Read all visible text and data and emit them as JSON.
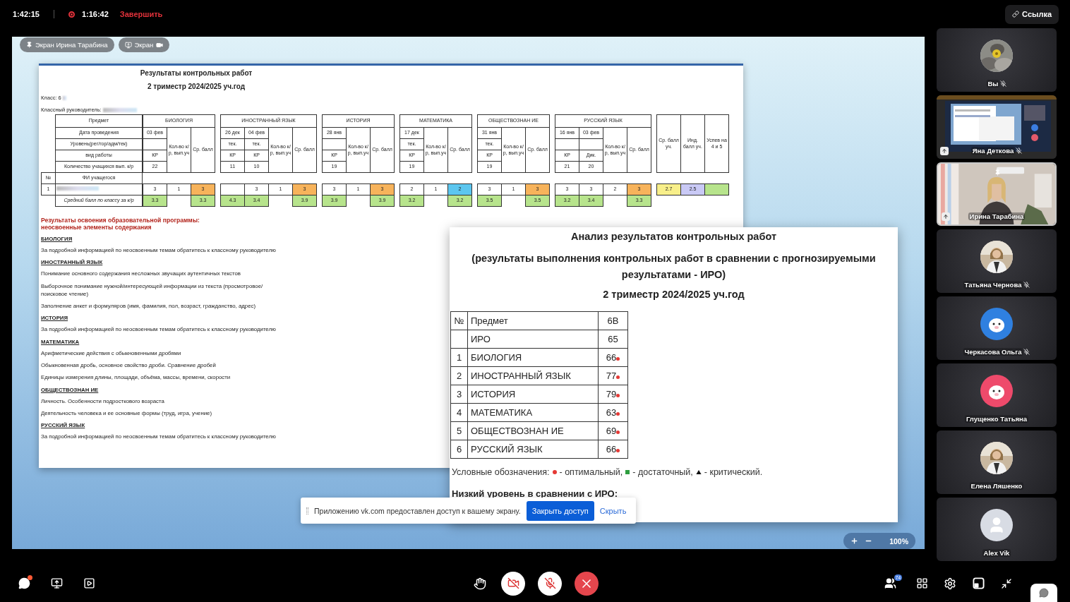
{
  "top_bar": {
    "elapsed": "1:42:15",
    "recording": {
      "on": true,
      "time": "1:16:42",
      "stop": "Завершить"
    },
    "link_button": "Ссылка"
  },
  "screen_tags": [
    {
      "kind": "pinned",
      "label": "Экран Ирина Тарабина"
    },
    {
      "kind": "own",
      "label": "Экран"
    }
  ],
  "document": {
    "title": "Результаты контрольных работ",
    "subtitle": "2 триместр 2024/2025 уч.год",
    "class_label": "Класс: 6",
    "teacher_label": "Классный руководитель:",
    "table": {
      "row_labels": [
        "Предмет",
        "Дата проведения",
        "Уровень(рег/гор/адм/тек)",
        "вид работы",
        "Количество учащихся вып. к/р"
      ],
      "number_label": "№",
      "name_label": "ФИ учащегося",
      "student_number": "1",
      "class_avg_label": "Средний балл по классу за к/р",
      "subjects": [
        {
          "name": "БИОЛОГИЯ",
          "count_label": "Кол-во к/р, вып.уч",
          "avg_label": "Ср. балл",
          "works": [
            {
              "date": "03 фев",
              "type": "КР",
              "count": "22",
              "mark": "3",
              "class_avg": "3.3"
            }
          ],
          "works_done": "1",
          "avg": {
            "value": "3",
            "color": "#f7b35b"
          },
          "class_avg": "3.3"
        },
        {
          "name": "ИНОСТРАННЫЙ ЯЗЫК",
          "count_label": "Кол-во к/р, вып.уч",
          "avg_label": "Ср. балл",
          "works": [
            {
              "date": "26 дек",
              "level": "тек.",
              "type": "КР",
              "count": "11",
              "class_avg": "4.3"
            },
            {
              "date": "04 фев",
              "level": "тек.",
              "type": "КР",
              "count": "10",
              "mark": "3",
              "class_avg": "3.4"
            }
          ],
          "works_done": "1",
          "avg": {
            "value": "3",
            "color": "#f7b35b"
          },
          "class_avg": "3.9"
        },
        {
          "name": "ИСТОРИЯ",
          "count_label": "Кол-во к/р, вып.уч",
          "avg_label": "Ср. балл",
          "works": [
            {
              "date": "28 янв",
              "type": "КР",
              "count": "19",
              "mark": "3",
              "class_avg": "3.9"
            }
          ],
          "works_done": "1",
          "avg": {
            "value": "3",
            "color": "#f7b35b"
          },
          "class_avg": "3.9"
        },
        {
          "name": "МАТЕМАТИКА",
          "count_label": "Кол-во к/р, вып.уч",
          "avg_label": "Ср. балл",
          "works": [
            {
              "date": "17 дек",
              "level": "тек.",
              "type": "КР",
              "count": "19",
              "mark": "2",
              "class_avg": "3.2"
            }
          ],
          "works_done": "1",
          "avg": {
            "value": "2",
            "color": "#5cc6ef"
          },
          "class_avg": "3.2"
        },
        {
          "name": "ОБЩЕСТВОЗНАН ИЕ",
          "count_label": "Кол-во к/р, вып.уч",
          "avg_label": "Ср. балл",
          "works": [
            {
              "date": "31 янв",
              "level": "тек.",
              "type": "КР",
              "count": "19",
              "mark": "3",
              "class_avg": "3.5"
            }
          ],
          "works_done": "1",
          "avg": {
            "value": "3",
            "color": "#f7b35b"
          },
          "class_avg": "3.5"
        },
        {
          "name": "РУССКИЙ ЯЗЫК",
          "count_label": "Кол-во к/р, вып.уч",
          "avg_label": "Ср. балл",
          "works": [
            {
              "date": "16 янв",
              "type": "КР",
              "count": "21",
              "mark": "3",
              "class_avg": "3.2"
            },
            {
              "date": "03 фев",
              "type": "Дик.",
              "count": "20",
              "mark": "3",
              "class_avg": "3.4"
            }
          ],
          "works_done": "2",
          "avg": {
            "value": "3",
            "color": "#f7b35b"
          },
          "class_avg": "3.3"
        }
      ],
      "summary": [
        {
          "label": "Ср. балл уч.",
          "value": "2.7",
          "color": "#f8ef8a"
        },
        {
          "label": "Инд. балл уч.",
          "value": "2.5",
          "color": "#c9c9f5"
        },
        {
          "label": "Успев на 4 и 5",
          "color": "#b7e48c"
        }
      ]
    },
    "results": {
      "heading": [
        "Результаты освоения образовательной программы:",
        "неосвоенные элементы содержания"
      ],
      "sections": [
        {
          "subject": "БИОЛОГИЯ",
          "items": [
            "За подробной информацией по неосвоенным темам обратитесь к классному руководителю"
          ]
        },
        {
          "subject": "ИНОСТРАННЫЙ ЯЗЫК",
          "items": [
            "Понимание основного содержания несложных звучащих аутентичных текстов",
            "Выборочное понимание нужной/интересующей информации из текста (просмотровое/ поисковое чтение)",
            "Заполнение анкет и формуляров (имя, фамилия, пол, возраст, гражданство, адрес)"
          ]
        },
        {
          "subject": "ИСТОРИЯ",
          "items": [
            "За подробной информацией по неосвоенным темам обратитесь к классному руководителю"
          ]
        },
        {
          "subject": "МАТЕМАТИКА",
          "items": [
            "Арифметические действия с обыкновенными дробями",
            "Обыкновенная дробь, основное свойство дроби. Сравнение дробей",
            "Единицы измерения длины, площади, объёма, массы, времени, скорости"
          ]
        },
        {
          "subject": "ОБЩЕСТВОЗНАН ИЕ",
          "items": [
            "Личность. Особенности подросткового возраста",
            "Деятельность человека и ее основные формы (труд, игра, учение)"
          ]
        },
        {
          "subject": "РУССКИЙ ЯЗЫК",
          "items": [
            "За подробной информацией по неосвоенным темам обратитесь к классному руководителю"
          ]
        }
      ]
    }
  },
  "analysis": {
    "title": "Анализ результатов контрольных работ",
    "subtitle": "(результаты выполнения контрольных работ в сравнении с прогнозируемыми результатами - ИРО)",
    "period": "2 триместр 2024/2025 уч.год",
    "columns": [
      "№",
      "Предмет",
      "6В"
    ],
    "rows": [
      {
        "subject": "ИРО",
        "value": "65"
      },
      {
        "number": "1",
        "subject": "БИОЛОГИЯ",
        "value": "66",
        "kind": "dot",
        "color": "#e53935"
      },
      {
        "number": "2",
        "subject": "ИНОСТРАННЫЙ ЯЗЫК",
        "value": "77",
        "kind": "dot",
        "color": "#e53935"
      },
      {
        "number": "3",
        "subject": "ИСТОРИЯ",
        "value": "79",
        "kind": "dot",
        "color": "#e53935"
      },
      {
        "number": "4",
        "subject": "МАТЕМАТИКА",
        "value": "63",
        "kind": "dot",
        "color": "#e53935"
      },
      {
        "number": "5",
        "subject": "ОБЩЕСТВОЗНАН ИЕ",
        "value": "69",
        "kind": "dot",
        "color": "#e53935"
      },
      {
        "number": "6",
        "subject": "РУССКИЙ ЯЗЫК",
        "value": "66",
        "kind": "dot",
        "color": "#e53935"
      }
    ],
    "legend": {
      "label": "Условные обозначения:",
      "items": [
        {
          "kind": "dot",
          "color": "#e53935",
          "text": "- оптимальный,"
        },
        {
          "kind": "square",
          "color": "#2e9e3f",
          "text": "- достаточный,"
        },
        {
          "kind": "triangle",
          "color": "#111111",
          "text": "- критический."
        }
      ]
    },
    "low_heading": "Низкий уровень в сравнении с ИРО:"
  },
  "notification": {
    "text": "Приложению vk.com предоставлен доступ к вашему экрану.",
    "action": "Закрыть доступ",
    "dismiss": "Скрыть"
  },
  "zoom": {
    "value": "100%"
  },
  "participants": [
    {
      "name": "Вы",
      "kind": "picture",
      "muted": true,
      "sharing": false,
      "pinned": false,
      "selected": false
    },
    {
      "name": "Яна Деткова",
      "kind": "screen",
      "muted": true,
      "sharing": true,
      "pinned": false,
      "selected": false
    },
    {
      "name": "Ирина Тарабина",
      "kind": "video",
      "muted": false,
      "sharing": true,
      "pinned": true,
      "selected": true
    },
    {
      "name": "Татьяна Чернова",
      "kind": "picture",
      "muted": true,
      "sharing": false,
      "pinned": false,
      "selected": false
    },
    {
      "name": "Черкасова Ольга",
      "kind": "mascot",
      "color": "#2f80e0",
      "muted": true,
      "sharing": false,
      "pinned": false,
      "selected": false
    },
    {
      "name": "Глущенко Татьяна",
      "kind": "mascot",
      "color": "#ee4a6b",
      "muted": false,
      "sharing": false,
      "pinned": false,
      "selected": false
    },
    {
      "name": "Елена Ляшенко",
      "kind": "picture",
      "muted": false,
      "sharing": false,
      "pinned": false,
      "selected": false
    },
    {
      "name": "Alex Vik",
      "kind": "default",
      "muted": false,
      "sharing": false,
      "pinned": false,
      "selected": false
    }
  ],
  "controls": {
    "chat_unread": true,
    "camera_on": false,
    "mic_on": false,
    "participants_count": "74"
  }
}
